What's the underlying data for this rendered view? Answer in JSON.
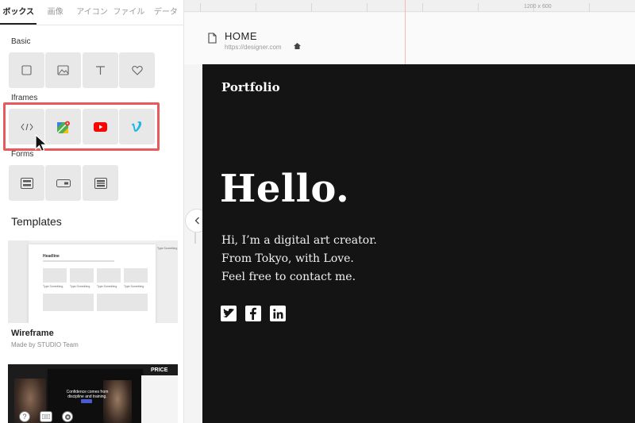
{
  "tabs": [
    "ボックス",
    "画像",
    "アイコン",
    "ファイル",
    "データ"
  ],
  "sections": {
    "basic": "Basic",
    "iframes": "Iframes",
    "forms": "Forms",
    "templates": "Templates"
  },
  "templates": [
    {
      "name": "Wireframe",
      "author": "Made by STUDIO Team",
      "thumb": {
        "headline": "Headline",
        "cap": "Type Something",
        "side_cap": "Type Something"
      }
    },
    {
      "thumb": {
        "headline": "Confidence comes from discipline and training.",
        "side_title": "PRICE"
      }
    }
  ],
  "ruler": {
    "label": "1200 x 600"
  },
  "page": {
    "name": "HOME",
    "url": "https://designer.com"
  },
  "site": {
    "logo": "Portfolio",
    "headline": "Hello.",
    "lines": [
      "Hi, I’m a digital art creator.",
      "From Tokyo, with Love.",
      "Feel free to contact me."
    ]
  },
  "icons": {
    "collapse": "chevron-left-icon",
    "social": [
      "twitter-icon",
      "facebook-icon",
      "linkedin-icon"
    ]
  },
  "colors": {
    "highlight": "#e85a5d",
    "canvas_bg": "#141414",
    "youtube": "#ff0000",
    "vimeo": "#1ab7ea"
  }
}
